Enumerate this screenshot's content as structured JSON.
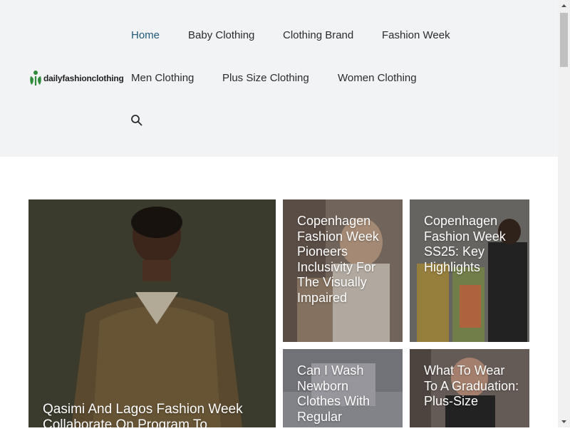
{
  "site": {
    "logo_text": "dailyfashionclothing"
  },
  "nav": {
    "items": [
      {
        "label": "Home",
        "active": true
      },
      {
        "label": "Baby Clothing"
      },
      {
        "label": "Clothing Brand"
      },
      {
        "label": "Fashion Week"
      },
      {
        "label": "Men Clothing"
      },
      {
        "label": "Plus Size Clothing"
      },
      {
        "label": "Women Clothing"
      }
    ],
    "search_icon": "search-icon"
  },
  "cards": [
    {
      "title": "Qasimi And Lagos Fashion Week Collaborate On Program To"
    },
    {
      "title": "Copenhagen Fashion Week Pioneers Inclusivity For The Visually Impaired"
    },
    {
      "title": "Copenhagen Fashion Week SS25: Key Highlights"
    },
    {
      "title": "Can I Wash Newborn Clothes With Regular"
    },
    {
      "title": "What To Wear To A Graduation: Plus-Size"
    }
  ],
  "colors": {
    "header_bg": "#f2f3f5",
    "nav_active": "#1e5b78",
    "logo_green": "#2e8b3a"
  }
}
